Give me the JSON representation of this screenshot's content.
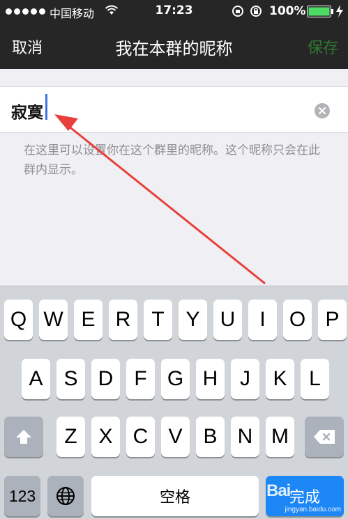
{
  "status_bar": {
    "carrier": "中国移动",
    "time": "17:23",
    "battery": "100%",
    "icons": [
      "signal-dots-icon",
      "wifi-icon",
      "rotation-lock-icon",
      "alarm-lock-icon",
      "battery-icon",
      "charging-bolt-icon"
    ]
  },
  "nav": {
    "cancel": "取消",
    "title": "我在本群的昵称",
    "save": "保存"
  },
  "form": {
    "nickname_value": "寂寞",
    "hint": "在这里可以设置你在这个群里的昵称。这个昵称只会在此群内显示。"
  },
  "keyboard": {
    "row1": [
      "Q",
      "W",
      "E",
      "R",
      "T",
      "Y",
      "U",
      "I",
      "O",
      "P"
    ],
    "row2": [
      "A",
      "S",
      "D",
      "F",
      "G",
      "H",
      "J",
      "K",
      "L"
    ],
    "row3": [
      "Z",
      "X",
      "C",
      "V",
      "B",
      "N",
      "M"
    ],
    "numbers_key": "123",
    "space_key": "空格",
    "done_key": "完成"
  },
  "watermark": {
    "logo": "Bai",
    "url": "jingyan.baidu.com"
  },
  "colors": {
    "bar_bg": "#262626",
    "save_green": "#2f7a30",
    "done_blue": "#1d87f5",
    "arrow_red": "#e8403b",
    "caret_blue": "#3f72e5"
  }
}
